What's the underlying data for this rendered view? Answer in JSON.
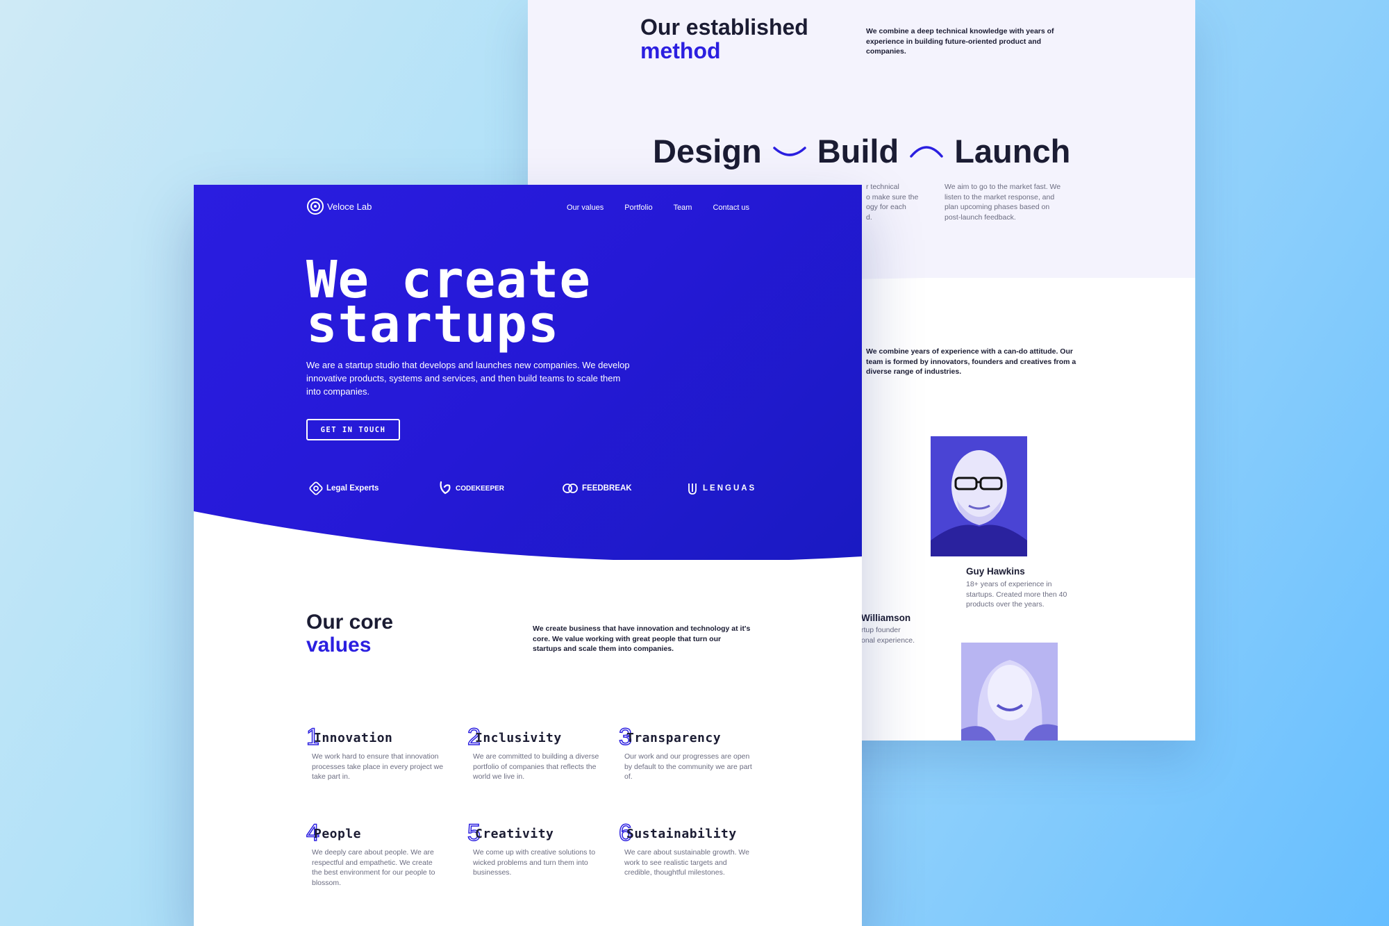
{
  "back_page": {
    "method_title": "Our established",
    "method_title_accent": "method",
    "method_intro": "We combine a deep technical knowledge with years of experience in building future-oriented product and companies.",
    "steps": [
      "Design",
      "Build",
      "Launch"
    ],
    "step_descs": {
      "build_partial": "r technical\no make sure the\nogy for each\nd.",
      "launch": "We aim to go to the market fast. We listen to the market response, and plan upcoming phases based on post-launch feedback."
    },
    "team_intro": "We combine years of experience with a can-do attitude. Our team is formed by innovators, founders and creatives from a diverse range of industries.",
    "members": [
      {
        "name": "Guy Hawkins",
        "bio": "18+ years of experience in startups. Created more then 40 products over the years."
      },
      {
        "name": "Williamson",
        "bio": "rtup founder\nonal experience."
      }
    ]
  },
  "front_page": {
    "brand": "Veloce Lab",
    "nav": [
      "Our values",
      "Portfolio",
      "Team",
      "Contact us"
    ],
    "hero_title_line1": "We create",
    "hero_title_line2": "startups",
    "hero_subtitle": "We are a startup studio that develops and launches new companies. We develop innovative products, systems and services, and then build teams to scale them into companies.",
    "cta_label": "GET IN TOUCH",
    "partners": [
      "Legal Experts",
      "CODEKEEPER",
      "FEEDBREAK",
      "LENGUAS"
    ],
    "core_values_title": "Our core",
    "core_values_title_accent": "values",
    "core_values_intro": "We create business that have innovation and technology at it's core. We value working with great people that turn our startups and scale them into companies.",
    "values": [
      {
        "num": "1",
        "title": "Innovation",
        "desc": "We work hard to ensure that innovation processes take place in every project we take part in."
      },
      {
        "num": "2",
        "title": "Inclusivity",
        "desc": "We are committed to building a diverse portfolio of companies that reflects the world we live in."
      },
      {
        "num": "3",
        "title": "Transparency",
        "desc": "Our work and our progresses are open by default to the community we are part of."
      },
      {
        "num": "4",
        "title": "People",
        "desc": "We deeply care about people. We are respectful and empathetic. We create the best environment for our people to blossom."
      },
      {
        "num": "5",
        "title": "Creativity",
        "desc": "We come up with creative solutions to wicked problems and turn them into businesses."
      },
      {
        "num": "6",
        "title": "Sustainability",
        "desc": "We care about sustainable growth. We work to see realistic targets and credible, thoughtful milestones."
      }
    ]
  },
  "colors": {
    "primary": "#2b1fe0",
    "dark_text": "#1b1c33",
    "muted_text": "#6b6c80",
    "back_section_bg": "#f4f3fd"
  }
}
